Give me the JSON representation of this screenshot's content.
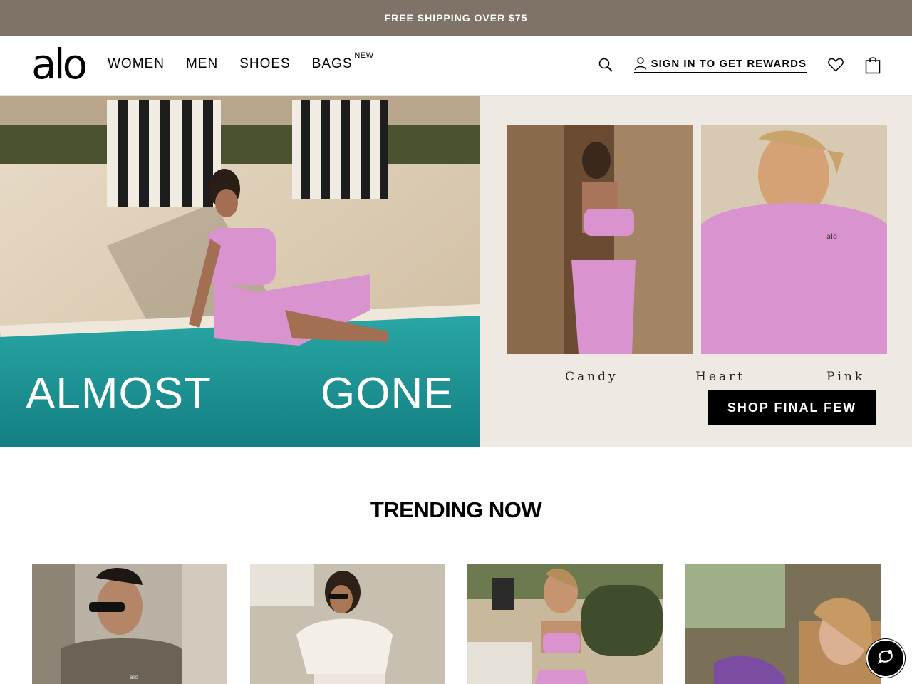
{
  "promo": {
    "text": "FREE SHIPPING OVER $75"
  },
  "header": {
    "logo": "alo",
    "nav": [
      {
        "label": "WOMEN"
      },
      {
        "label": "MEN"
      },
      {
        "label": "SHOES"
      },
      {
        "label": "BAGS",
        "badge": "NEW"
      }
    ],
    "signin_label": "SIGN IN TO GET REWARDS",
    "icons": [
      "search-icon",
      "user-icon",
      "heart-icon",
      "shopping-bag-icon"
    ]
  },
  "hero": {
    "headline_left": "ALMOST",
    "headline_right": "GONE",
    "captions": [
      "Candy",
      "Heart",
      "Pink"
    ],
    "cta": "SHOP FINAL FEW",
    "product_logo": "alo"
  },
  "trending": {
    "title": "TRENDING NOW",
    "products": [
      {
        "image": "model in olive hoodie and sunglasses"
      },
      {
        "image": "model in cream cropped sweatshirt"
      },
      {
        "image": "model in pink sports bra"
      },
      {
        "image": "model in purple knit set"
      }
    ],
    "product_logo": "alo"
  },
  "colors": {
    "promo_bg": "#7e7366",
    "hero_right_bg": "#efe9e3",
    "accent_pink": "#d993cf",
    "pool_teal": "#1f9a9a"
  },
  "chat": {
    "icon": "chat-icon"
  }
}
